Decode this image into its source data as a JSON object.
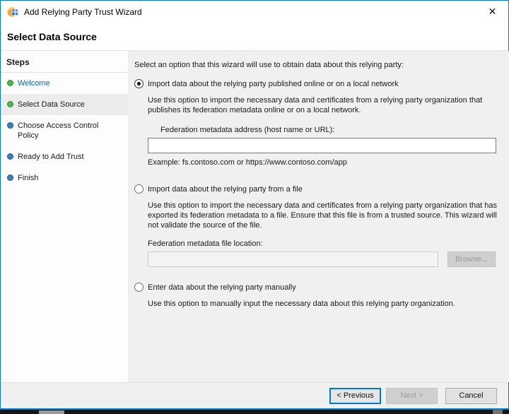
{
  "window": {
    "title": "Add Relying Party Trust Wizard",
    "close_glyph": "✕",
    "page_title": "Select Data Source"
  },
  "sidebar": {
    "title": "Steps",
    "items": [
      {
        "label": "Welcome",
        "state": "done",
        "link": true
      },
      {
        "label": "Select Data Source",
        "state": "current"
      },
      {
        "label": "Choose Access Control Policy",
        "state": "upcoming"
      },
      {
        "label": "Ready to Add Trust",
        "state": "upcoming"
      },
      {
        "label": "Finish",
        "state": "upcoming"
      }
    ]
  },
  "content": {
    "intro": "Select an option that this wizard will use to obtain data about this relying party:",
    "options": [
      {
        "label": "Import data about the relying party published online or on a local network",
        "selected": true,
        "description": "Use this option to import the necessary data and certificates from a relying party organization that publishes its federation metadata online or on a local network.",
        "field_label": "Federation metadata address (host name or URL):",
        "field_value": "",
        "example": "Example: fs.contoso.com or https://www.contoso.com/app"
      },
      {
        "label": "Import data about the relying party from a file",
        "selected": false,
        "description": "Use this option to import the necessary data and certificates from a relying party organization that has exported its federation metadata to a file. Ensure that this file is from a trusted source.  This wizard will not validate the source of the file.",
        "field_label": "Federation metadata file location:",
        "field_value": "",
        "browse_label": "Browse..."
      },
      {
        "label": "Enter data about the relying party manually",
        "selected": false,
        "description": "Use this option to manually input the necessary data about this relying party organization."
      }
    ]
  },
  "footer": {
    "previous_label": "< Previous",
    "next_label": "Next >",
    "cancel_label": "Cancel"
  },
  "icons": {
    "app_icon": "adfs-wizard-icon",
    "close_icon": "close-icon"
  },
  "colors": {
    "window_border": "#0079d8",
    "content_bg": "#f0f0f0",
    "sidebar_bg": "#fdfdfd",
    "current_step_bg": "#ececec",
    "step_done_bullet": "#4db848",
    "step_upcoming_bullet": "#3a7ec0",
    "link_text": "#0066cc",
    "default_button_border": "#0078d7",
    "disabled_button_bg": "#cfcfcf",
    "disabled_text": "#9a9a9a"
  }
}
